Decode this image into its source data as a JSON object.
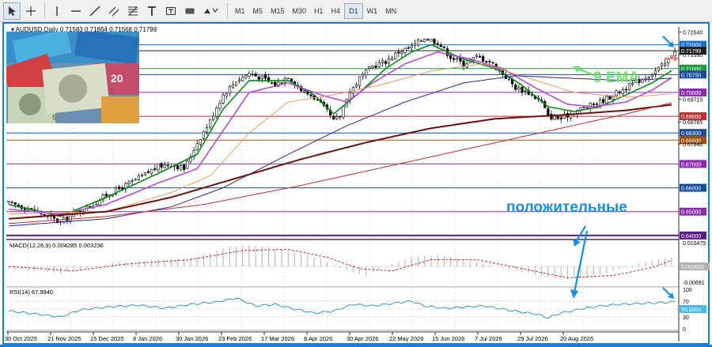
{
  "toolbar": {
    "timeframes": [
      "M1",
      "M5",
      "M15",
      "M30",
      "H1",
      "H4",
      "D1",
      "W1",
      "MN"
    ],
    "tools": [
      "cursor-icon",
      "crosshair-icon",
      "vertical-line-icon",
      "horizontal-line-icon",
      "trendline-icon",
      "channel-icon",
      "fibonacci-icon",
      "text-icon",
      "text-label-icon",
      "rectangle-icon",
      "shapes-icon"
    ]
  },
  "colors": {
    "frame": "#1a7fd6",
    "ema9": "#0a8a1a",
    "ema_violet": "#b54ad3",
    "ema_orange": "#e0a060",
    "ema_navy": "#2a2a8c",
    "ema_maroon": "#6a1010",
    "ema_red": "#c03030",
    "annotation_blue": "#1a8fe0",
    "annotation_green": "#6ee06e",
    "up_candle": "#ffffff",
    "down_candle": "#000000"
  },
  "chart_data": [
    {
      "type": "candlestick",
      "title": "AUDUSD,Daily",
      "ohlc_header": "0.71583 0.71864 0.71568 0.71799",
      "x_tick_labels": [
        "30 Oct 2025",
        "21 Nov 2025",
        "15 Dec 2025",
        "8 Jan 2026",
        "30 Jan 2026",
        "23 Feb 2026",
        "17 Mar 2026",
        "8 Apr 2026",
        "30 Apr 2026",
        "22 May 2026",
        "15 Jun 2026",
        "7 Jul 2026",
        "29 Jul 2026",
        "20 Aug 2026"
      ],
      "y_tick_labels": [
        "0.72540",
        "0.71590",
        "0.70750",
        "0.69715",
        "0.68765",
        "0.67840",
        "0.66000",
        "0.65000",
        "0.64000"
      ],
      "ylim": [
        0.6393,
        0.7275
      ],
      "price_levels": [
        {
          "value": 0.72,
          "label": "0.72000",
          "color": "#1a6fd0"
        },
        {
          "value": 0.7175,
          "label": "0.71799",
          "color": "#202020"
        },
        {
          "value": 0.71,
          "label": "0.71000",
          "color": "#1a9a3a"
        },
        {
          "value": 0.7075,
          "label": "0.70750",
          "color": "#1a4a9a"
        },
        {
          "value": 0.7,
          "label": "0.70000",
          "color": "#8a2ab0"
        },
        {
          "value": 0.69,
          "label": "0.69000",
          "color": "#c03030"
        },
        {
          "value": 0.683,
          "label": "0.68300",
          "color": "#1a4a9a"
        },
        {
          "value": 0.68,
          "label": "0.68000",
          "color": "#a05010"
        },
        {
          "value": 0.67,
          "label": "0.67000",
          "color": "#8a2ab0"
        },
        {
          "value": 0.66,
          "label": "0.66000",
          "color": "#1a4a9a"
        },
        {
          "value": 0.65,
          "label": "0.65000",
          "color": "#8a2ab0"
        },
        {
          "value": 0.64,
          "label": "0.64000",
          "color": "#5a1a8a"
        }
      ],
      "close_path": [
        [
          0,
          0.6535
        ],
        [
          6,
          0.6515
        ],
        [
          12,
          0.648
        ],
        [
          16,
          0.6455
        ],
        [
          20,
          0.649
        ],
        [
          26,
          0.653
        ],
        [
          30,
          0.657
        ],
        [
          36,
          0.661
        ],
        [
          40,
          0.664
        ],
        [
          46,
          0.669
        ],
        [
          50,
          0.67
        ],
        [
          54,
          0.668
        ],
        [
          58,
          0.679
        ],
        [
          62,
          0.688
        ],
        [
          64,
          0.694
        ],
        [
          66,
          0.699
        ],
        [
          70,
          0.705
        ],
        [
          74,
          0.708
        ],
        [
          78,
          0.706
        ],
        [
          82,
          0.703
        ],
        [
          86,
          0.707
        ],
        [
          90,
          0.701
        ],
        [
          94,
          0.698
        ],
        [
          98,
          0.692
        ],
        [
          100,
          0.688
        ],
        [
          102,
          0.69
        ],
        [
          104,
          0.698
        ],
        [
          108,
          0.706
        ],
        [
          112,
          0.711
        ],
        [
          116,
          0.713
        ],
        [
          120,
          0.717
        ],
        [
          124,
          0.719
        ],
        [
          128,
          0.723
        ],
        [
          132,
          0.721
        ],
        [
          136,
          0.715
        ],
        [
          140,
          0.712
        ],
        [
          144,
          0.715
        ],
        [
          148,
          0.713
        ],
        [
          152,
          0.708
        ],
        [
          156,
          0.702
        ],
        [
          160,
          0.7
        ],
        [
          164,
          0.696
        ],
        [
          166,
          0.69
        ],
        [
          170,
          0.689
        ],
        [
          174,
          0.692
        ],
        [
          178,
          0.694
        ],
        [
          182,
          0.696
        ],
        [
          186,
          0.699
        ],
        [
          190,
          0.702
        ],
        [
          194,
          0.705
        ],
        [
          198,
          0.708
        ],
        [
          202,
          0.712
        ],
        [
          205,
          0.718
        ]
      ],
      "ma_lines": [
        {
          "id": "ema9",
          "name": "9 EMA",
          "color": "#0a8a1a",
          "width": 1.6,
          "points": [
            [
              0,
              0.653
            ],
            [
              16,
              0.648
            ],
            [
              30,
              0.656
            ],
            [
              46,
              0.666
            ],
            [
              58,
              0.674
            ],
            [
              66,
              0.693
            ],
            [
              74,
              0.705
            ],
            [
              86,
              0.705
            ],
            [
              94,
              0.699
            ],
            [
              100,
              0.691
            ],
            [
              108,
              0.7
            ],
            [
              116,
              0.71
            ],
            [
              124,
              0.717
            ],
            [
              130,
              0.72
            ],
            [
              140,
              0.714
            ],
            [
              150,
              0.71
            ],
            [
              158,
              0.703
            ],
            [
              166,
              0.694
            ],
            [
              174,
              0.692
            ],
            [
              182,
              0.694
            ],
            [
              190,
              0.699
            ],
            [
              198,
              0.704
            ],
            [
              205,
              0.71
            ]
          ]
        },
        {
          "id": "ema_violet",
          "color": "#b54ad3",
          "width": 1.6,
          "points": [
            [
              0,
              0.651
            ],
            [
              16,
              0.649
            ],
            [
              30,
              0.653
            ],
            [
              46,
              0.662
            ],
            [
              58,
              0.668
            ],
            [
              66,
              0.684
            ],
            [
              74,
              0.7
            ],
            [
              86,
              0.704
            ],
            [
              96,
              0.699
            ],
            [
              104,
              0.696
            ],
            [
              112,
              0.704
            ],
            [
              122,
              0.712
            ],
            [
              132,
              0.717
            ],
            [
              142,
              0.714
            ],
            [
              152,
              0.71
            ],
            [
              162,
              0.702
            ],
            [
              172,
              0.695
            ],
            [
              180,
              0.694
            ],
            [
              190,
              0.696
            ],
            [
              198,
              0.701
            ],
            [
              205,
              0.707
            ]
          ]
        },
        {
          "id": "ema_orange",
          "color": "#e0a060",
          "width": 1.0,
          "points": [
            [
              0,
              0.649
            ],
            [
              30,
              0.65
            ],
            [
              50,
              0.658
            ],
            [
              62,
              0.665
            ],
            [
              74,
              0.683
            ],
            [
              86,
              0.696
            ],
            [
              100,
              0.699
            ],
            [
              114,
              0.703
            ],
            [
              130,
              0.709
            ],
            [
              146,
              0.712
            ],
            [
              160,
              0.706
            ],
            [
              174,
              0.7
            ],
            [
              190,
              0.698
            ],
            [
              205,
              0.6995
            ]
          ]
        },
        {
          "id": "ema_navy",
          "color": "#2a2a8c",
          "width": 1.0,
          "points": [
            [
              0,
              0.644
            ],
            [
              30,
              0.647
            ],
            [
              50,
              0.652
            ],
            [
              66,
              0.66
            ],
            [
              86,
              0.674
            ],
            [
              104,
              0.686
            ],
            [
              122,
              0.696
            ],
            [
              140,
              0.704
            ],
            [
              156,
              0.707
            ],
            [
              172,
              0.706
            ],
            [
              190,
              0.705
            ],
            [
              205,
              0.706
            ]
          ]
        },
        {
          "id": "ema_maroon",
          "color": "#6a1010",
          "width": 2.0,
          "points": [
            [
              0,
              0.647
            ],
            [
              30,
              0.65
            ],
            [
              50,
              0.656
            ],
            [
              70,
              0.664
            ],
            [
              90,
              0.672
            ],
            [
              110,
              0.679
            ],
            [
              130,
              0.685
            ],
            [
              150,
              0.689
            ],
            [
              170,
              0.6905
            ],
            [
              190,
              0.6925
            ],
            [
              205,
              0.695
            ]
          ]
        },
        {
          "id": "ema_red",
          "color": "#c03030",
          "width": 1.0,
          "points": [
            [
              0,
              0.645
            ],
            [
              30,
              0.648
            ],
            [
              60,
              0.653
            ],
            [
              90,
              0.661
            ],
            [
              120,
              0.67
            ],
            [
              150,
              0.679
            ],
            [
              170,
              0.685
            ],
            [
              190,
              0.691
            ],
            [
              205,
              0.696
            ]
          ]
        }
      ]
    },
    {
      "type": "histogram",
      "title": "MACD(12,26,9) 0.004285 0.003236",
      "y_tick_labels": [
        "0.010475",
        "0.000000",
        "-0.00691"
      ],
      "ylim": [
        -0.008,
        0.0115
      ],
      "hist_path": [
        [
          0,
          -0.001
        ],
        [
          16,
          -0.003
        ],
        [
          30,
          0.001
        ],
        [
          46,
          0.003
        ],
        [
          58,
          0.004
        ],
        [
          66,
          0.008
        ],
        [
          74,
          0.0096
        ],
        [
          86,
          0.007
        ],
        [
          96,
          0.003
        ],
        [
          102,
          -0.001
        ],
        [
          110,
          -0.004
        ],
        [
          114,
          -0.001
        ],
        [
          124,
          0.004
        ],
        [
          132,
          0.005
        ],
        [
          140,
          0.003
        ],
        [
          150,
          0.0
        ],
        [
          160,
          -0.003
        ],
        [
          170,
          -0.006
        ],
        [
          178,
          -0.005
        ],
        [
          186,
          -0.002
        ],
        [
          196,
          0.002
        ],
        [
          205,
          0.0043
        ]
      ],
      "signal_path": [
        [
          0,
          0.0
        ],
        [
          20,
          -0.002
        ],
        [
          36,
          0.001
        ],
        [
          56,
          0.003
        ],
        [
          72,
          0.007
        ],
        [
          86,
          0.0075
        ],
        [
          98,
          0.004
        ],
        [
          108,
          -0.001
        ],
        [
          118,
          -0.002
        ],
        [
          130,
          0.003
        ],
        [
          144,
          0.003
        ],
        [
          158,
          -0.001
        ],
        [
          172,
          -0.005
        ],
        [
          186,
          -0.004
        ],
        [
          198,
          -0.0005
        ],
        [
          205,
          0.0032
        ]
      ]
    },
    {
      "type": "line",
      "title": "RSI(14) 67.9940",
      "y_tick_labels": [
        "100",
        "70",
        "50.0000",
        "30",
        "0"
      ],
      "ylim": [
        0,
        100
      ],
      "levels": [
        70,
        50,
        30
      ],
      "series": [
        {
          "color": "#2a88c8",
          "values": [
            [
              0,
              45
            ],
            [
              8,
              38
            ],
            [
              16,
              30
            ],
            [
              22,
              48
            ],
            [
              30,
              55
            ],
            [
              40,
              60
            ],
            [
              48,
              52
            ],
            [
              56,
              62
            ],
            [
              64,
              68
            ],
            [
              70,
              78
            ],
            [
              76,
              58
            ],
            [
              82,
              62
            ],
            [
              88,
              50
            ],
            [
              94,
              40
            ],
            [
              100,
              45
            ],
            [
              106,
              62
            ],
            [
              112,
              58
            ],
            [
              118,
              64
            ],
            [
              124,
              70
            ],
            [
              128,
              58
            ],
            [
              134,
              52
            ],
            [
              140,
              55
            ],
            [
              146,
              58
            ],
            [
              152,
              50
            ],
            [
              158,
              42
            ],
            [
              162,
              38
            ],
            [
              166,
              28
            ],
            [
              170,
              40
            ],
            [
              176,
              50
            ],
            [
              182,
              58
            ],
            [
              188,
              62
            ],
            [
              194,
              64
            ],
            [
              200,
              66
            ],
            [
              205,
              68
            ]
          ]
        }
      ]
    }
  ],
  "annotations": {
    "ema_label": "9 EMA",
    "russian_label": "положительные"
  }
}
